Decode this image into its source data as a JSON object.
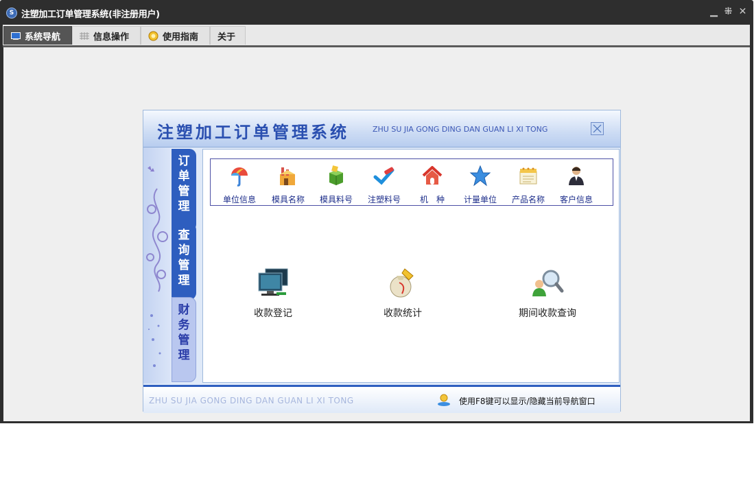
{
  "window": {
    "title": "注塑加工订单管理系统(非注册用户)",
    "icon": "app-logo-icon",
    "controls": [
      "minimize-icon",
      "restore-icon",
      "close-icon"
    ]
  },
  "tabs": [
    {
      "label": "系统导航",
      "icon": "monitor-icon",
      "active": true
    },
    {
      "label": "信息操作",
      "icon": "grid-icon",
      "active": false
    },
    {
      "label": "使用指南",
      "icon": "guide-icon",
      "active": false
    },
    {
      "label": "关于",
      "icon": "",
      "active": false
    }
  ],
  "nav": {
    "title": "注塑加工订单管理系统",
    "pinyin": "ZHU SU JIA GONG DING DAN GUAN LI XI TONG",
    "side_tabs": [
      {
        "label": "订单管理",
        "active": true
      },
      {
        "label": "查询管理",
        "active": true
      },
      {
        "label": "财务管理",
        "active": false
      }
    ],
    "icon_row": [
      {
        "label": "单位信息",
        "icon": "umbrella-icon"
      },
      {
        "label": "模具名称",
        "icon": "factory-icon"
      },
      {
        "label": "模具料号",
        "icon": "box-icon"
      },
      {
        "label": "注塑料号",
        "icon": "crayon-icon"
      },
      {
        "label": "机　种",
        "icon": "house-icon"
      },
      {
        "label": "计量单位",
        "icon": "star-icon"
      },
      {
        "label": "产品名称",
        "icon": "notepad-icon"
      },
      {
        "label": "客户信息",
        "icon": "person-icon"
      }
    ],
    "actions": [
      {
        "label": "收款登记",
        "icon": "monitors-icon"
      },
      {
        "label": "收款统计",
        "icon": "money-bag-icon"
      },
      {
        "label": "期间收款查询",
        "icon": "user-search-icon"
      }
    ],
    "footer": {
      "pinyin": "ZHU SU JIA GONG DING DAN GUAN LI XI TONG",
      "hint": "使用F8键可以显示/隐藏当前导航窗口"
    }
  }
}
